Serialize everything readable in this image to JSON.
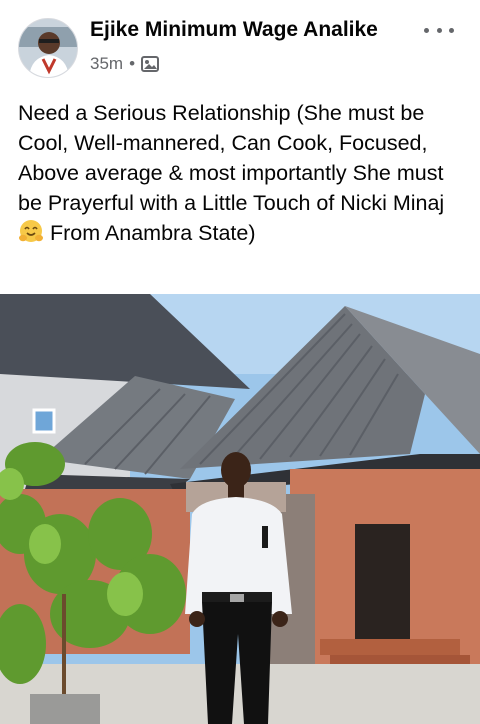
{
  "post": {
    "author_name": "Ejike Minimum Wage Analike",
    "timestamp": "35m",
    "separator": "•",
    "audience_icon": "photo-album-icon",
    "more_icon": "more-options-icon",
    "text_part1": "Need a Serious Relationship (She must be Cool, Well-mannered, Can Cook, Focused, Above average & most importantly She must be Prayerful with a Little Touch of Nicki Minaj",
    "emoji_icon": "hugging-face-emoji",
    "text_part2": "From Anambra State)"
  },
  "photo": {
    "subject": "man-in-white-shirt-standing-in-front-of-house-icon"
  },
  "colors": {
    "name_text": "#050505",
    "meta_text": "#65676b",
    "sky": "#9cc6ea",
    "roof": "#6e7176",
    "wall": "#c77a5c",
    "ground": "#d8d6d0"
  }
}
